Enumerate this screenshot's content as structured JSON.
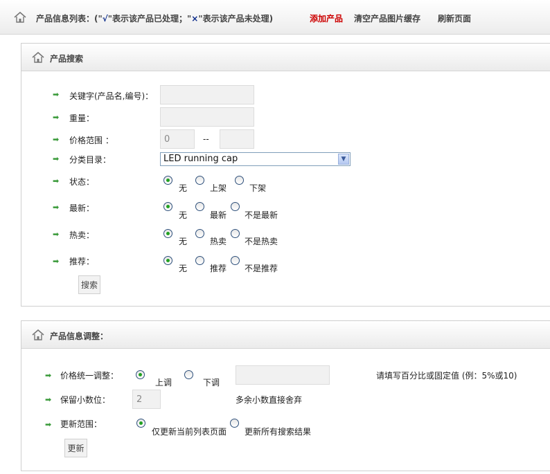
{
  "topbar": {
    "title_prefix": "产品信息列表：(\"",
    "tick": "√",
    "title_mid": "\"表示该产品已处理；\"",
    "cross": "×",
    "title_suffix": "\"表示该产品未处理)",
    "add_product": "添加产品",
    "clear_cache": "清空产品图片缓存",
    "refresh": "刷新页面"
  },
  "search": {
    "title": "产品搜索",
    "keyword_label": "关键字(产品名,编号)：",
    "keyword_value": "",
    "weight_label": "重量：",
    "weight_value": "",
    "price_label": "价格范围  ：",
    "price_min": "0",
    "price_sep": "--",
    "price_max": "",
    "category_label": "分类目录：",
    "category_selected": "LED running cap",
    "status_label": "状态：",
    "status_options": [
      "无",
      "上架",
      "下架"
    ],
    "newest_label": "最新：",
    "newest_options": [
      "无",
      "最新",
      "不是最新"
    ],
    "hot_label": "热卖：",
    "hot_options": [
      "无",
      "热卖",
      "不是热卖"
    ],
    "recommend_label": "推荐：",
    "recommend_options": [
      "无",
      "推荐",
      "不是推荐"
    ],
    "search_button": "搜索"
  },
  "adjust": {
    "title": "产品信息调整：",
    "price_adjust_label": "价格统一调整：",
    "price_adjust_up": "上调",
    "price_adjust_down": "下调",
    "price_adjust_value": "",
    "price_adjust_hint": "请填写百分比或固定值 (例：5%或10)",
    "decimals_label": "保留小数位：",
    "decimals_value": "2",
    "decimals_hint": "多余小数直接舍弃",
    "range_label": "更新范围：",
    "range_current": "仅更新当前列表页面",
    "range_all": "更新所有搜索结果",
    "update_button": "更新"
  },
  "icons": {
    "home": "home-icon",
    "arrow": "arrow-right-icon",
    "dropdown": "chevron-down-icon"
  },
  "colors": {
    "accent_red": "#cc0000",
    "arrow_green": "#3a9a3a",
    "radio_checked": "#21a121"
  }
}
